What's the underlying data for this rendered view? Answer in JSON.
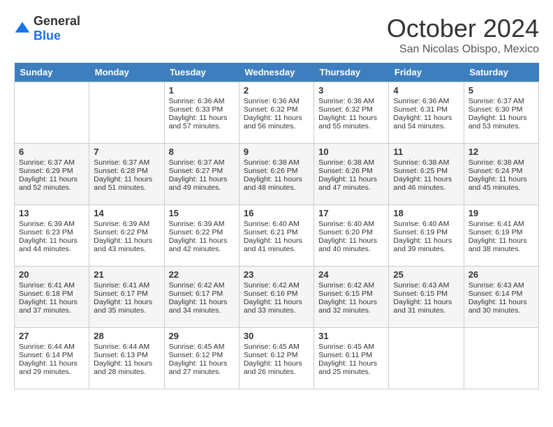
{
  "header": {
    "logo_general": "General",
    "logo_blue": "Blue",
    "month": "October 2024",
    "location": "San Nicolas Obispo, Mexico"
  },
  "days_of_week": [
    "Sunday",
    "Monday",
    "Tuesday",
    "Wednesday",
    "Thursday",
    "Friday",
    "Saturday"
  ],
  "weeks": [
    [
      {
        "day": "",
        "sunrise": "",
        "sunset": "",
        "daylight": ""
      },
      {
        "day": "",
        "sunrise": "",
        "sunset": "",
        "daylight": ""
      },
      {
        "day": "1",
        "sunrise": "Sunrise: 6:36 AM",
        "sunset": "Sunset: 6:33 PM",
        "daylight": "Daylight: 11 hours and 57 minutes."
      },
      {
        "day": "2",
        "sunrise": "Sunrise: 6:36 AM",
        "sunset": "Sunset: 6:32 PM",
        "daylight": "Daylight: 11 hours and 56 minutes."
      },
      {
        "day": "3",
        "sunrise": "Sunrise: 6:36 AM",
        "sunset": "Sunset: 6:32 PM",
        "daylight": "Daylight: 11 hours and 55 minutes."
      },
      {
        "day": "4",
        "sunrise": "Sunrise: 6:36 AM",
        "sunset": "Sunset: 6:31 PM",
        "daylight": "Daylight: 11 hours and 54 minutes."
      },
      {
        "day": "5",
        "sunrise": "Sunrise: 6:37 AM",
        "sunset": "Sunset: 6:30 PM",
        "daylight": "Daylight: 11 hours and 53 minutes."
      }
    ],
    [
      {
        "day": "6",
        "sunrise": "Sunrise: 6:37 AM",
        "sunset": "Sunset: 6:29 PM",
        "daylight": "Daylight: 11 hours and 52 minutes."
      },
      {
        "day": "7",
        "sunrise": "Sunrise: 6:37 AM",
        "sunset": "Sunset: 6:28 PM",
        "daylight": "Daylight: 11 hours and 51 minutes."
      },
      {
        "day": "8",
        "sunrise": "Sunrise: 6:37 AM",
        "sunset": "Sunset: 6:27 PM",
        "daylight": "Daylight: 11 hours and 49 minutes."
      },
      {
        "day": "9",
        "sunrise": "Sunrise: 6:38 AM",
        "sunset": "Sunset: 6:26 PM",
        "daylight": "Daylight: 11 hours and 48 minutes."
      },
      {
        "day": "10",
        "sunrise": "Sunrise: 6:38 AM",
        "sunset": "Sunset: 6:26 PM",
        "daylight": "Daylight: 11 hours and 47 minutes."
      },
      {
        "day": "11",
        "sunrise": "Sunrise: 6:38 AM",
        "sunset": "Sunset: 6:25 PM",
        "daylight": "Daylight: 11 hours and 46 minutes."
      },
      {
        "day": "12",
        "sunrise": "Sunrise: 6:38 AM",
        "sunset": "Sunset: 6:24 PM",
        "daylight": "Daylight: 11 hours and 45 minutes."
      }
    ],
    [
      {
        "day": "13",
        "sunrise": "Sunrise: 6:39 AM",
        "sunset": "Sunset: 6:23 PM",
        "daylight": "Daylight: 11 hours and 44 minutes."
      },
      {
        "day": "14",
        "sunrise": "Sunrise: 6:39 AM",
        "sunset": "Sunset: 6:22 PM",
        "daylight": "Daylight: 11 hours and 43 minutes."
      },
      {
        "day": "15",
        "sunrise": "Sunrise: 6:39 AM",
        "sunset": "Sunset: 6:22 PM",
        "daylight": "Daylight: 11 hours and 42 minutes."
      },
      {
        "day": "16",
        "sunrise": "Sunrise: 6:40 AM",
        "sunset": "Sunset: 6:21 PM",
        "daylight": "Daylight: 11 hours and 41 minutes."
      },
      {
        "day": "17",
        "sunrise": "Sunrise: 6:40 AM",
        "sunset": "Sunset: 6:20 PM",
        "daylight": "Daylight: 11 hours and 40 minutes."
      },
      {
        "day": "18",
        "sunrise": "Sunrise: 6:40 AM",
        "sunset": "Sunset: 6:19 PM",
        "daylight": "Daylight: 11 hours and 39 minutes."
      },
      {
        "day": "19",
        "sunrise": "Sunrise: 6:41 AM",
        "sunset": "Sunset: 6:19 PM",
        "daylight": "Daylight: 11 hours and 38 minutes."
      }
    ],
    [
      {
        "day": "20",
        "sunrise": "Sunrise: 6:41 AM",
        "sunset": "Sunset: 6:18 PM",
        "daylight": "Daylight: 11 hours and 37 minutes."
      },
      {
        "day": "21",
        "sunrise": "Sunrise: 6:41 AM",
        "sunset": "Sunset: 6:17 PM",
        "daylight": "Daylight: 11 hours and 35 minutes."
      },
      {
        "day": "22",
        "sunrise": "Sunrise: 6:42 AM",
        "sunset": "Sunset: 6:17 PM",
        "daylight": "Daylight: 11 hours and 34 minutes."
      },
      {
        "day": "23",
        "sunrise": "Sunrise: 6:42 AM",
        "sunset": "Sunset: 6:16 PM",
        "daylight": "Daylight: 11 hours and 33 minutes."
      },
      {
        "day": "24",
        "sunrise": "Sunrise: 6:42 AM",
        "sunset": "Sunset: 6:15 PM",
        "daylight": "Daylight: 11 hours and 32 minutes."
      },
      {
        "day": "25",
        "sunrise": "Sunrise: 6:43 AM",
        "sunset": "Sunset: 6:15 PM",
        "daylight": "Daylight: 11 hours and 31 minutes."
      },
      {
        "day": "26",
        "sunrise": "Sunrise: 6:43 AM",
        "sunset": "Sunset: 6:14 PM",
        "daylight": "Daylight: 11 hours and 30 minutes."
      }
    ],
    [
      {
        "day": "27",
        "sunrise": "Sunrise: 6:44 AM",
        "sunset": "Sunset: 6:14 PM",
        "daylight": "Daylight: 11 hours and 29 minutes."
      },
      {
        "day": "28",
        "sunrise": "Sunrise: 6:44 AM",
        "sunset": "Sunset: 6:13 PM",
        "daylight": "Daylight: 11 hours and 28 minutes."
      },
      {
        "day": "29",
        "sunrise": "Sunrise: 6:45 AM",
        "sunset": "Sunset: 6:12 PM",
        "daylight": "Daylight: 11 hours and 27 minutes."
      },
      {
        "day": "30",
        "sunrise": "Sunrise: 6:45 AM",
        "sunset": "Sunset: 6:12 PM",
        "daylight": "Daylight: 11 hours and 26 minutes."
      },
      {
        "day": "31",
        "sunrise": "Sunrise: 6:45 AM",
        "sunset": "Sunset: 6:11 PM",
        "daylight": "Daylight: 11 hours and 25 minutes."
      },
      {
        "day": "",
        "sunrise": "",
        "sunset": "",
        "daylight": ""
      },
      {
        "day": "",
        "sunrise": "",
        "sunset": "",
        "daylight": ""
      }
    ]
  ]
}
